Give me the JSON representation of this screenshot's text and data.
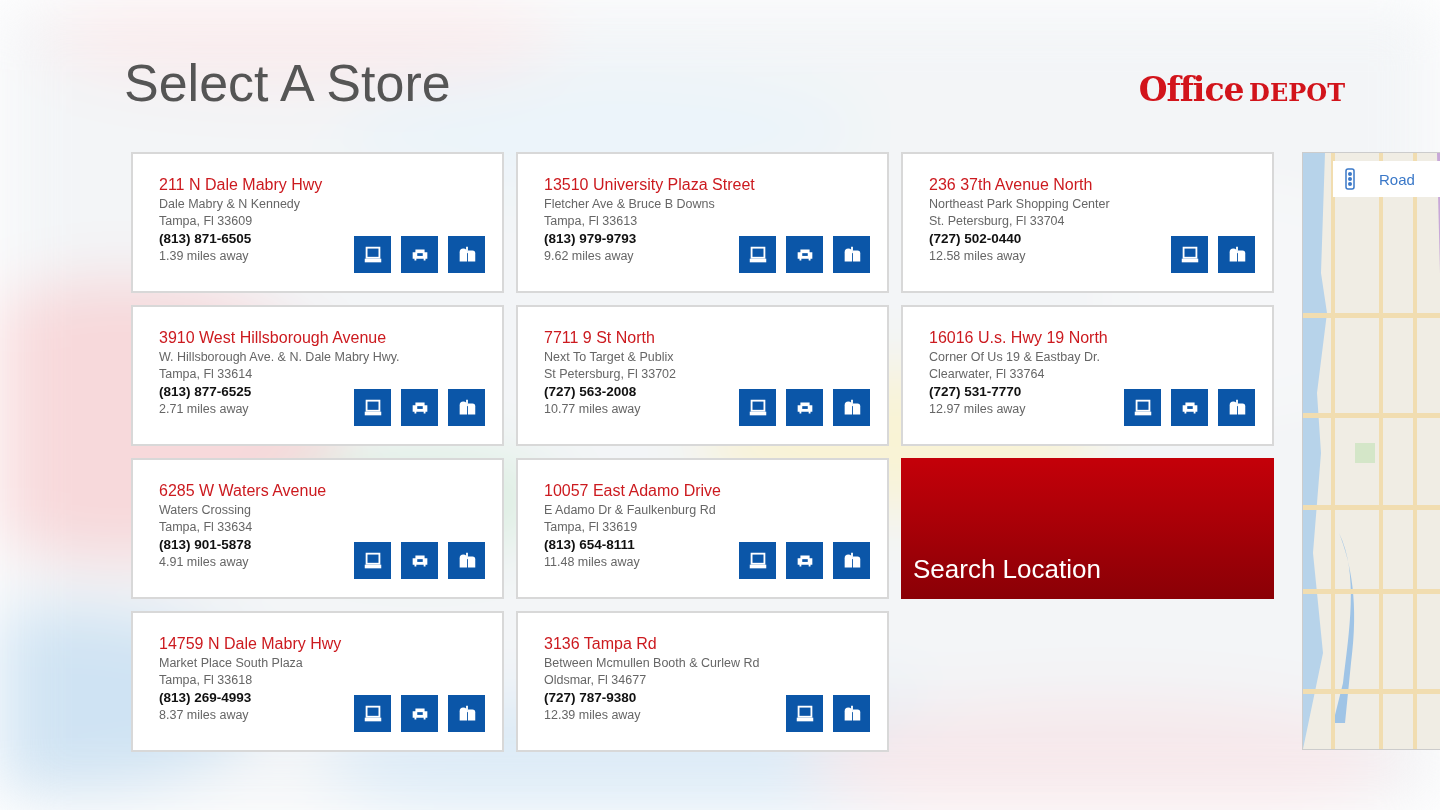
{
  "title": "Select A Store",
  "logo": {
    "word_1": "Office",
    "word_2": "DEPOT"
  },
  "stores": [
    {
      "address": "211 N Dale Mabry Hwy",
      "cross_streets": "Dale Mabry & N Kennedy",
      "city": "Tampa, Fl 33609",
      "phone": "(813) 871-6505",
      "distance": "1.39 miles away",
      "services": [
        {
          "kind": "tech"
        },
        {
          "kind": "furniture"
        },
        {
          "kind": "mail"
        }
      ]
    },
    {
      "address": "13510 University Plaza Street",
      "cross_streets": "Fletcher Ave & Bruce B Downs",
      "city": "Tampa, Fl 33613",
      "phone": "(813) 979-9793",
      "distance": "9.62 miles away",
      "services": [
        {
          "kind": "tech"
        },
        {
          "kind": "furniture"
        },
        {
          "kind": "mail"
        }
      ]
    },
    {
      "address": "236 37th Avenue North",
      "cross_streets": "Northeast Park Shopping Center",
      "city": "St. Petersburg, Fl 33704",
      "phone": "(727) 502-0440",
      "distance": "12.58 miles away",
      "services": [
        {
          "kind": "tech"
        },
        {
          "kind": "mail"
        }
      ]
    },
    {
      "address": "3910 West Hillsborough Avenue",
      "cross_streets": "W. Hillsborough Ave. & N. Dale Mabry Hwy.",
      "city": "Tampa, Fl 33614",
      "phone": "(813) 877-6525",
      "distance": "2.71 miles away",
      "services": [
        {
          "kind": "tech"
        },
        {
          "kind": "furniture"
        },
        {
          "kind": "mail"
        }
      ]
    },
    {
      "address": "7711 9 St North",
      "cross_streets": "Next To Target & Publix",
      "city": "St Petersburg, Fl 33702",
      "phone": "(727) 563-2008",
      "distance": "10.77 miles away",
      "services": [
        {
          "kind": "tech"
        },
        {
          "kind": "furniture"
        },
        {
          "kind": "mail"
        }
      ]
    },
    {
      "address": "16016 U.s. Hwy 19 North",
      "cross_streets": "Corner Of Us 19 & Eastbay Dr.",
      "city": "Clearwater, Fl 33764",
      "phone": "(727) 531-7770",
      "distance": "12.97 miles away",
      "services": [
        {
          "kind": "tech"
        },
        {
          "kind": "furniture"
        },
        {
          "kind": "mail"
        }
      ]
    },
    {
      "address": "6285 W Waters Avenue",
      "cross_streets": "Waters Crossing",
      "city": "Tampa, Fl 33634",
      "phone": "(813) 901-5878",
      "distance": "4.91 miles away",
      "services": [
        {
          "kind": "tech"
        },
        {
          "kind": "furniture"
        },
        {
          "kind": "mail"
        }
      ]
    },
    {
      "address": "10057 East Adamo Drive",
      "cross_streets": "E Adamo Dr & Faulkenburg Rd",
      "city": "Tampa, Fl 33619",
      "phone": "(813) 654-8111",
      "distance": "11.48 miles away",
      "services": [
        {
          "kind": "tech"
        },
        {
          "kind": "furniture"
        },
        {
          "kind": "mail"
        }
      ]
    },
    {
      "address": "14759 N Dale Mabry Hwy",
      "cross_streets": "Market Place South Plaza",
      "city": "Tampa, Fl 33618",
      "phone": "(813) 269-4993",
      "distance": "8.37 miles away",
      "services": [
        {
          "kind": "tech"
        },
        {
          "kind": "furniture"
        },
        {
          "kind": "mail"
        }
      ]
    },
    {
      "address": "3136 Tampa Rd",
      "cross_streets": "Between Mcmullen Booth & Curlew Rd",
      "city": "Oldsmar, Fl 34677",
      "phone": "(727) 787-9380",
      "distance": "12.39 miles away",
      "services": [
        {
          "kind": "tech"
        },
        {
          "kind": "mail"
        }
      ]
    }
  ],
  "search_tile": {
    "label": "Search Location"
  },
  "map": {
    "kind": "picture",
    "style_selector": {
      "label": "Road"
    }
  }
}
